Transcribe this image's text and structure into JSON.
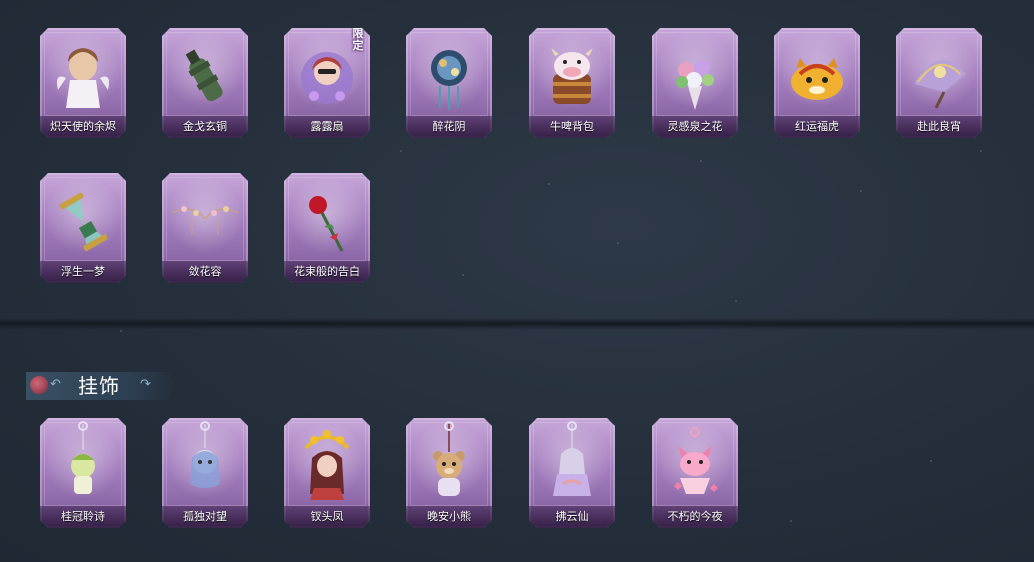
{
  "items": [
    {
      "name": "炽天使的余烬",
      "icon": "angel-doll-icon",
      "tag": ""
    },
    {
      "name": "金戈玄铜",
      "icon": "bronze-grenade-icon",
      "tag": ""
    },
    {
      "name": "露露扇",
      "icon": "girl-fan-icon",
      "tag": "限定"
    },
    {
      "name": "醉花阴",
      "icon": "flower-fan-icon",
      "tag": ""
    },
    {
      "name": "牛啤背包",
      "icon": "cow-barrel-backpack-icon",
      "tag": ""
    },
    {
      "name": "灵感泉之花",
      "icon": "flower-bouquet-icon",
      "tag": ""
    },
    {
      "name": "红运福虎",
      "icon": "lucky-tiger-icon",
      "tag": ""
    },
    {
      "name": "赴此良宵",
      "icon": "night-fan-icon",
      "tag": ""
    },
    {
      "name": "浮生一梦",
      "icon": "hourglass-scroll-icon",
      "tag": ""
    },
    {
      "name": "敛花容",
      "icon": "flower-vine-icon",
      "tag": ""
    },
    {
      "name": "花束般的告白",
      "icon": "red-rose-icon",
      "tag": ""
    }
  ],
  "section": {
    "title": "挂饰",
    "icon": "pendant-badge-icon"
  },
  "pendants": [
    {
      "name": "桂冠聆诗",
      "icon": "laurel-charm-icon"
    },
    {
      "name": "孤独对望",
      "icon": "lonely-charm-icon"
    },
    {
      "name": "钗头凤",
      "icon": "phoenix-hairpin-charm-icon"
    },
    {
      "name": "晚安小熊",
      "icon": "bear-charm-icon"
    },
    {
      "name": "拂云仙",
      "icon": "cloud-fairy-charm-icon"
    },
    {
      "name": "不朽的今夜",
      "icon": "pink-cat-cake-charm-icon"
    }
  ]
}
